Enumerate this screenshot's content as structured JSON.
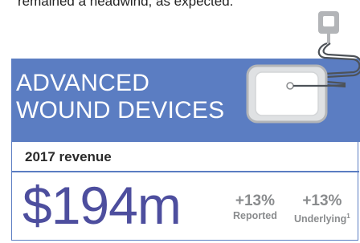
{
  "intro": {
    "text": "remained a headwind, as expected."
  },
  "section": {
    "title_line1": "ADVANCED",
    "title_line2": "WOUND DEVICES"
  },
  "revenue": {
    "label": "2017 revenue",
    "value": "$194m",
    "metrics": [
      {
        "change": "+13%",
        "label": "Reported",
        "footnote": ""
      },
      {
        "change": "+13%",
        "label": "Underlying",
        "footnote": "1"
      }
    ]
  },
  "colors": {
    "panel_blue": "#5b7dc2",
    "value_purple": "#4d4e9e",
    "metric_grey": "#8a8c8e",
    "device_grey": "#b3b5b8"
  },
  "icons": [
    "wound-device-icon",
    "device-plug-icon",
    "tube-icon"
  ]
}
